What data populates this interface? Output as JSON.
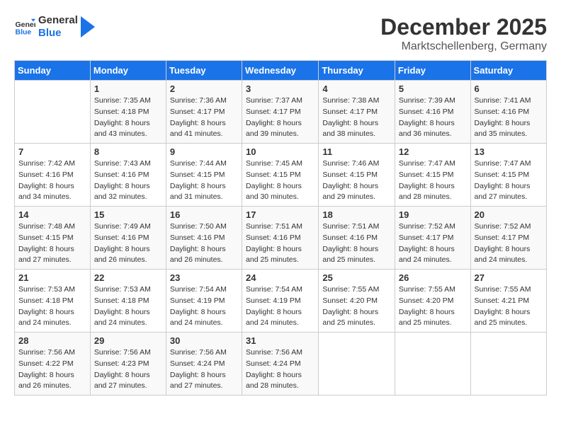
{
  "header": {
    "logo_line1": "General",
    "logo_line2": "Blue",
    "month": "December 2025",
    "location": "Marktschellenberg, Germany"
  },
  "days_of_week": [
    "Sunday",
    "Monday",
    "Tuesday",
    "Wednesday",
    "Thursday",
    "Friday",
    "Saturday"
  ],
  "weeks": [
    [
      {
        "day": "",
        "sunrise": "",
        "sunset": "",
        "daylight": ""
      },
      {
        "day": "1",
        "sunrise": "Sunrise: 7:35 AM",
        "sunset": "Sunset: 4:18 PM",
        "daylight": "Daylight: 8 hours and 43 minutes."
      },
      {
        "day": "2",
        "sunrise": "Sunrise: 7:36 AM",
        "sunset": "Sunset: 4:17 PM",
        "daylight": "Daylight: 8 hours and 41 minutes."
      },
      {
        "day": "3",
        "sunrise": "Sunrise: 7:37 AM",
        "sunset": "Sunset: 4:17 PM",
        "daylight": "Daylight: 8 hours and 39 minutes."
      },
      {
        "day": "4",
        "sunrise": "Sunrise: 7:38 AM",
        "sunset": "Sunset: 4:17 PM",
        "daylight": "Daylight: 8 hours and 38 minutes."
      },
      {
        "day": "5",
        "sunrise": "Sunrise: 7:39 AM",
        "sunset": "Sunset: 4:16 PM",
        "daylight": "Daylight: 8 hours and 36 minutes."
      },
      {
        "day": "6",
        "sunrise": "Sunrise: 7:41 AM",
        "sunset": "Sunset: 4:16 PM",
        "daylight": "Daylight: 8 hours and 35 minutes."
      }
    ],
    [
      {
        "day": "7",
        "sunrise": "Sunrise: 7:42 AM",
        "sunset": "Sunset: 4:16 PM",
        "daylight": "Daylight: 8 hours and 34 minutes."
      },
      {
        "day": "8",
        "sunrise": "Sunrise: 7:43 AM",
        "sunset": "Sunset: 4:16 PM",
        "daylight": "Daylight: 8 hours and 32 minutes."
      },
      {
        "day": "9",
        "sunrise": "Sunrise: 7:44 AM",
        "sunset": "Sunset: 4:15 PM",
        "daylight": "Daylight: 8 hours and 31 minutes."
      },
      {
        "day": "10",
        "sunrise": "Sunrise: 7:45 AM",
        "sunset": "Sunset: 4:15 PM",
        "daylight": "Daylight: 8 hours and 30 minutes."
      },
      {
        "day": "11",
        "sunrise": "Sunrise: 7:46 AM",
        "sunset": "Sunset: 4:15 PM",
        "daylight": "Daylight: 8 hours and 29 minutes."
      },
      {
        "day": "12",
        "sunrise": "Sunrise: 7:47 AM",
        "sunset": "Sunset: 4:15 PM",
        "daylight": "Daylight: 8 hours and 28 minutes."
      },
      {
        "day": "13",
        "sunrise": "Sunrise: 7:47 AM",
        "sunset": "Sunset: 4:15 PM",
        "daylight": "Daylight: 8 hours and 27 minutes."
      }
    ],
    [
      {
        "day": "14",
        "sunrise": "Sunrise: 7:48 AM",
        "sunset": "Sunset: 4:15 PM",
        "daylight": "Daylight: 8 hours and 27 minutes."
      },
      {
        "day": "15",
        "sunrise": "Sunrise: 7:49 AM",
        "sunset": "Sunset: 4:16 PM",
        "daylight": "Daylight: 8 hours and 26 minutes."
      },
      {
        "day": "16",
        "sunrise": "Sunrise: 7:50 AM",
        "sunset": "Sunset: 4:16 PM",
        "daylight": "Daylight: 8 hours and 26 minutes."
      },
      {
        "day": "17",
        "sunrise": "Sunrise: 7:51 AM",
        "sunset": "Sunset: 4:16 PM",
        "daylight": "Daylight: 8 hours and 25 minutes."
      },
      {
        "day": "18",
        "sunrise": "Sunrise: 7:51 AM",
        "sunset": "Sunset: 4:16 PM",
        "daylight": "Daylight: 8 hours and 25 minutes."
      },
      {
        "day": "19",
        "sunrise": "Sunrise: 7:52 AM",
        "sunset": "Sunset: 4:17 PM",
        "daylight": "Daylight: 8 hours and 24 minutes."
      },
      {
        "day": "20",
        "sunrise": "Sunrise: 7:52 AM",
        "sunset": "Sunset: 4:17 PM",
        "daylight": "Daylight: 8 hours and 24 minutes."
      }
    ],
    [
      {
        "day": "21",
        "sunrise": "Sunrise: 7:53 AM",
        "sunset": "Sunset: 4:18 PM",
        "daylight": "Daylight: 8 hours and 24 minutes."
      },
      {
        "day": "22",
        "sunrise": "Sunrise: 7:53 AM",
        "sunset": "Sunset: 4:18 PM",
        "daylight": "Daylight: 8 hours and 24 minutes."
      },
      {
        "day": "23",
        "sunrise": "Sunrise: 7:54 AM",
        "sunset": "Sunset: 4:19 PM",
        "daylight": "Daylight: 8 hours and 24 minutes."
      },
      {
        "day": "24",
        "sunrise": "Sunrise: 7:54 AM",
        "sunset": "Sunset: 4:19 PM",
        "daylight": "Daylight: 8 hours and 24 minutes."
      },
      {
        "day": "25",
        "sunrise": "Sunrise: 7:55 AM",
        "sunset": "Sunset: 4:20 PM",
        "daylight": "Daylight: 8 hours and 25 minutes."
      },
      {
        "day": "26",
        "sunrise": "Sunrise: 7:55 AM",
        "sunset": "Sunset: 4:20 PM",
        "daylight": "Daylight: 8 hours and 25 minutes."
      },
      {
        "day": "27",
        "sunrise": "Sunrise: 7:55 AM",
        "sunset": "Sunset: 4:21 PM",
        "daylight": "Daylight: 8 hours and 25 minutes."
      }
    ],
    [
      {
        "day": "28",
        "sunrise": "Sunrise: 7:56 AM",
        "sunset": "Sunset: 4:22 PM",
        "daylight": "Daylight: 8 hours and 26 minutes."
      },
      {
        "day": "29",
        "sunrise": "Sunrise: 7:56 AM",
        "sunset": "Sunset: 4:23 PM",
        "daylight": "Daylight: 8 hours and 27 minutes."
      },
      {
        "day": "30",
        "sunrise": "Sunrise: 7:56 AM",
        "sunset": "Sunset: 4:24 PM",
        "daylight": "Daylight: 8 hours and 27 minutes."
      },
      {
        "day": "31",
        "sunrise": "Sunrise: 7:56 AM",
        "sunset": "Sunset: 4:24 PM",
        "daylight": "Daylight: 8 hours and 28 minutes."
      },
      {
        "day": "",
        "sunrise": "",
        "sunset": "",
        "daylight": ""
      },
      {
        "day": "",
        "sunrise": "",
        "sunset": "",
        "daylight": ""
      },
      {
        "day": "",
        "sunrise": "",
        "sunset": "",
        "daylight": ""
      }
    ]
  ]
}
